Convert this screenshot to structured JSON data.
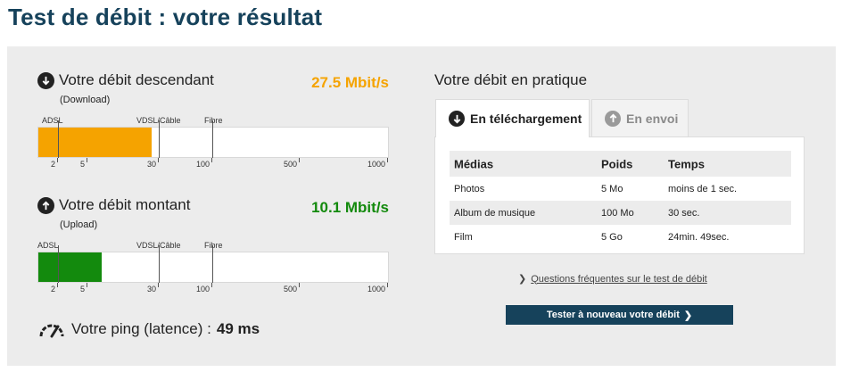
{
  "page": {
    "title": "Test de débit : votre résultat"
  },
  "download": {
    "title": "Votre débit descendant",
    "subtitle": "(Download)",
    "speed": "27.5 Mbit/s",
    "value_mbit": 27.5,
    "color": "#f5a300"
  },
  "upload": {
    "title": "Votre débit montant",
    "subtitle": "(Upload)",
    "speed": "10.1 Mbit/s",
    "value_mbit": 10.1,
    "color": "#138a0d"
  },
  "scale": {
    "zones": [
      "ADSL",
      "VDSL/Câble",
      "Fibre"
    ],
    "ticks": [
      "2",
      "5",
      "30",
      "100",
      "500",
      "1000"
    ]
  },
  "ping": {
    "label": "Votre ping (latence) :",
    "value": "49 ms"
  },
  "practice": {
    "title": "Votre débit en pratique",
    "tabs": [
      {
        "label": "En téléchargement",
        "icon": "arrow-down-circle-icon",
        "active": true
      },
      {
        "label": "En envoi",
        "icon": "arrow-up-circle-icon",
        "active": false
      }
    ],
    "table": {
      "headers": [
        "Médias",
        "Poids",
        "Temps"
      ],
      "rows": [
        [
          "Photos",
          "5 Mo",
          "moins de 1 sec."
        ],
        [
          "Album de musique",
          "100 Mo",
          "30 sec."
        ],
        [
          "Film",
          "5 Go",
          "24min. 49sec."
        ]
      ]
    }
  },
  "faq_link": "Questions fréquentes sur le test de débit",
  "retest_button": "Tester à nouveau votre débit",
  "colors": {
    "brand": "#16425b",
    "panel": "#ececec"
  }
}
